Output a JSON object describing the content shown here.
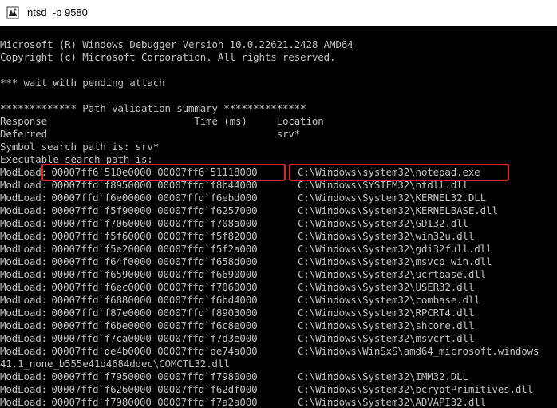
{
  "window": {
    "title": "ntsd  -p 9580",
    "icon": "debugger-icon"
  },
  "colors": {
    "console_bg": "#000000",
    "console_text": "#c0c0c0",
    "highlight": "#e02424",
    "titlebar_bg": "#ffffff"
  },
  "console": {
    "header": [
      "Microsoft (R) Windows Debugger Version 10.0.22621.2428 AMD64",
      "Copyright (c) Microsoft Corporation. All rights reserved."
    ],
    "blank_1": "",
    "wait_line": "*** wait with pending attach",
    "blank_2": "",
    "path_summary": "************* Path validation summary **************",
    "table_header": "Response                         Time (ms)     Location",
    "table_row": "Deferred                                       srv*",
    "symbol_path": "Symbol search path is: srv*",
    "exec_path": "Executable search path is:",
    "modloads": [
      {
        "prefix": "ModLoad:",
        "range": " 00007ff6`510e0000 00007ff6`51118000",
        "path": "C:\\Windows\\system32\\notepad.exe"
      },
      {
        "prefix": "ModLoad:",
        "range": " 00007ffd`f8950000 00007ffd`f8b44000",
        "path": "C:\\Windows\\SYSTEM32\\ntdll.dll"
      },
      {
        "prefix": "ModLoad:",
        "range": " 00007ffd`f6e00000 00007ffd`f6ebd000",
        "path": "C:\\Windows\\System32\\KERNEL32.DLL"
      },
      {
        "prefix": "ModLoad:",
        "range": " 00007ffd`f5f90000 00007ffd`f6257000",
        "path": "C:\\Windows\\System32\\KERNELBASE.dll"
      },
      {
        "prefix": "ModLoad:",
        "range": " 00007ffd`f7060000 00007ffd`f708a000",
        "path": "C:\\Windows\\System32\\GDI32.dll"
      },
      {
        "prefix": "ModLoad:",
        "range": " 00007ffd`f5f60000 00007ffd`f5f82000",
        "path": "C:\\Windows\\System32\\win32u.dll"
      },
      {
        "prefix": "ModLoad:",
        "range": " 00007ffd`f5e20000 00007ffd`f5f2a000",
        "path": "C:\\Windows\\System32\\gdi32full.dll"
      },
      {
        "prefix": "ModLoad:",
        "range": " 00007ffd`f64f0000 00007ffd`f658d000",
        "path": "C:\\Windows\\System32\\msvcp_win.dll"
      },
      {
        "prefix": "ModLoad:",
        "range": " 00007ffd`f6590000 00007ffd`f6690000",
        "path": "C:\\Windows\\System32\\ucrtbase.dll"
      },
      {
        "prefix": "ModLoad:",
        "range": " 00007ffd`f6ec0000 00007ffd`f7060000",
        "path": "C:\\Windows\\System32\\USER32.dll"
      },
      {
        "prefix": "ModLoad:",
        "range": " 00007ffd`f6880000 00007ffd`f6bd4000",
        "path": "C:\\Windows\\System32\\combase.dll"
      },
      {
        "prefix": "ModLoad:",
        "range": " 00007ffd`f87e0000 00007ffd`f8903000",
        "path": "C:\\Windows\\System32\\RPCRT4.dll"
      },
      {
        "prefix": "ModLoad:",
        "range": " 00007ffd`f6be0000 00007ffd`f6c8e000",
        "path": "C:\\Windows\\System32\\shcore.dll"
      },
      {
        "prefix": "ModLoad:",
        "range": " 00007ffd`f7ca0000 00007ffd`f7d3e000",
        "path": "C:\\Windows\\System32\\msvcrt.dll"
      },
      {
        "prefix": "ModLoad:",
        "range": " 00007ffd`de4b0000 00007ffd`de74a000",
        "path": "C:\\Windows\\WinSxS\\amd64_microsoft.windows"
      }
    ],
    "wrap_line": "41.1_none_b555e41d4684ddec\\COMCTL32.dll",
    "modloads_2": [
      {
        "prefix": "ModLoad:",
        "range": " 00007ffd`f7950000 00007ffd`f7980000",
        "path": "C:\\Windows\\System32\\IMM32.DLL"
      },
      {
        "prefix": "ModLoad:",
        "range": " 00007ffd`f6260000 00007ffd`f62df000",
        "path": "C:\\Windows\\System32\\bcryptPrimitives.dll"
      },
      {
        "prefix": "ModLoad:",
        "range": " 00007ffd`f7980000 00007ffd`f7a2a000",
        "path": "C:\\Windows\\System32\\ADVAPI32.dll"
      }
    ]
  }
}
